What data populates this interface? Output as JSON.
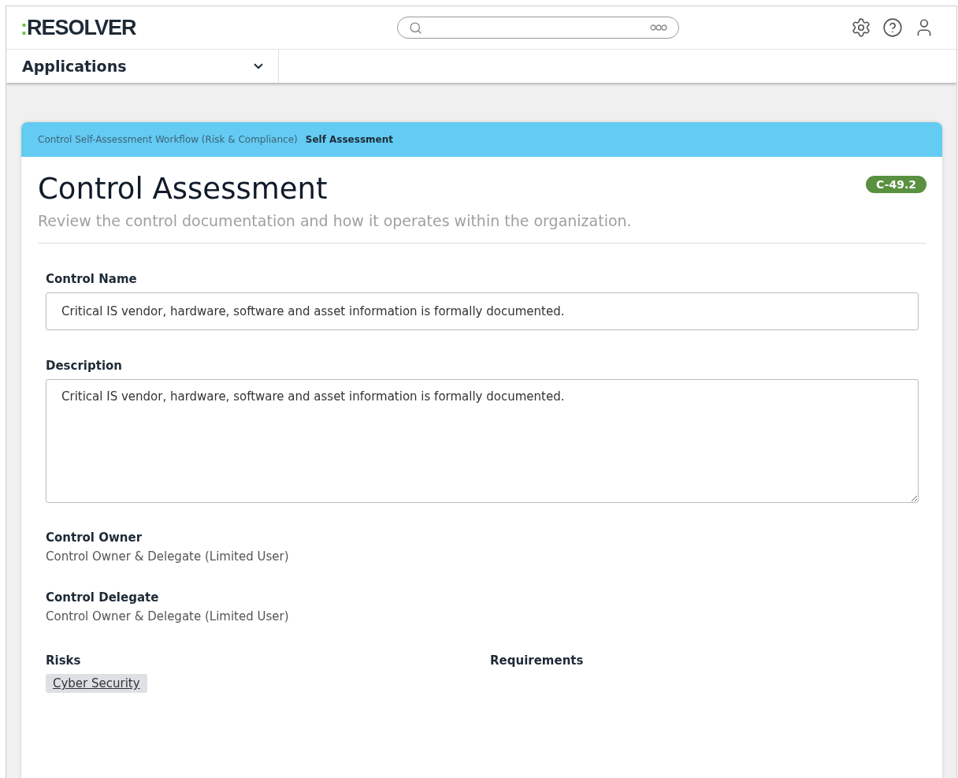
{
  "header": {
    "logo": {
      "prefix": ":",
      "text": "RESOLVER"
    },
    "app_menu": {
      "label": "Applications",
      "expanded": false
    }
  },
  "breadcrumb": [
    {
      "label": "Control Self-Assessment Workflow (Risk & Compliance)",
      "selected": false
    },
    {
      "label": "Self Assessment",
      "selected": true
    }
  ],
  "form": {
    "title": "Control Assessment",
    "badge": "C-49.2",
    "subtitle": "Review the control documentation and how it operates within the organization.",
    "fields": [
      {
        "kind": "input",
        "label": "Control Name",
        "value": "Critical IS vendor, hardware, software and asset information is formally documented."
      },
      {
        "kind": "textarea",
        "label": "Description",
        "value": "Critical IS vendor, hardware, software and asset information is formally documented."
      },
      {
        "kind": "text",
        "label": "Control Owner",
        "value": "Control Owner & Delegate (Limited User)"
      },
      {
        "kind": "text",
        "label": "Control Delegate",
        "value": "Control Owner & Delegate (Limited User)"
      }
    ],
    "relations": [
      {
        "label": "Risks",
        "tags": [
          "Cyber Security"
        ]
      },
      {
        "label": "Requirements"
      }
    ]
  }
}
